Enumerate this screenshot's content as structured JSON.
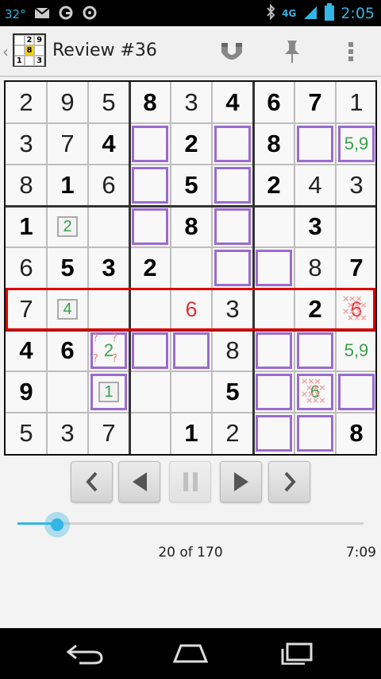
{
  "status_bar": {
    "temperature": "32°",
    "network": "4G",
    "time": "2:05"
  },
  "action_bar": {
    "title": "Review #36",
    "app_icon_digits": [
      "",
      "2",
      "9",
      "",
      "8",
      "",
      "1",
      "",
      "3"
    ]
  },
  "board": {
    "cells": [
      [
        "2",
        "9",
        "5",
        "8",
        "3",
        "4",
        "6",
        "7",
        "1"
      ],
      [
        "3",
        "7",
        "4",
        "",
        "2",
        "",
        "8",
        "",
        "5,9"
      ],
      [
        "8",
        "1",
        "6",
        "",
        "5",
        "",
        "2",
        "4",
        "3"
      ],
      [
        "1",
        "2",
        "",
        "",
        "8",
        "",
        "",
        "3",
        ""
      ],
      [
        "6",
        "5",
        "3",
        "2",
        "",
        "",
        "",
        "8",
        "7"
      ],
      [
        "7",
        "4",
        "",
        "",
        "6",
        "3",
        "",
        "2",
        "6"
      ],
      [
        "4",
        "6",
        "2",
        "",
        "",
        "8",
        "",
        "",
        "5,9"
      ],
      [
        "9",
        "",
        "1",
        "",
        "",
        "5",
        "",
        "6",
        ""
      ],
      [
        "5",
        "3",
        "7",
        "",
        "1",
        "2",
        "",
        "",
        "8"
      ]
    ],
    "question_marks": "?"
  },
  "controls": {
    "progress_text": "20 of 170",
    "elapsed_time": "7:09",
    "slider_value": 20,
    "slider_max": 170
  }
}
